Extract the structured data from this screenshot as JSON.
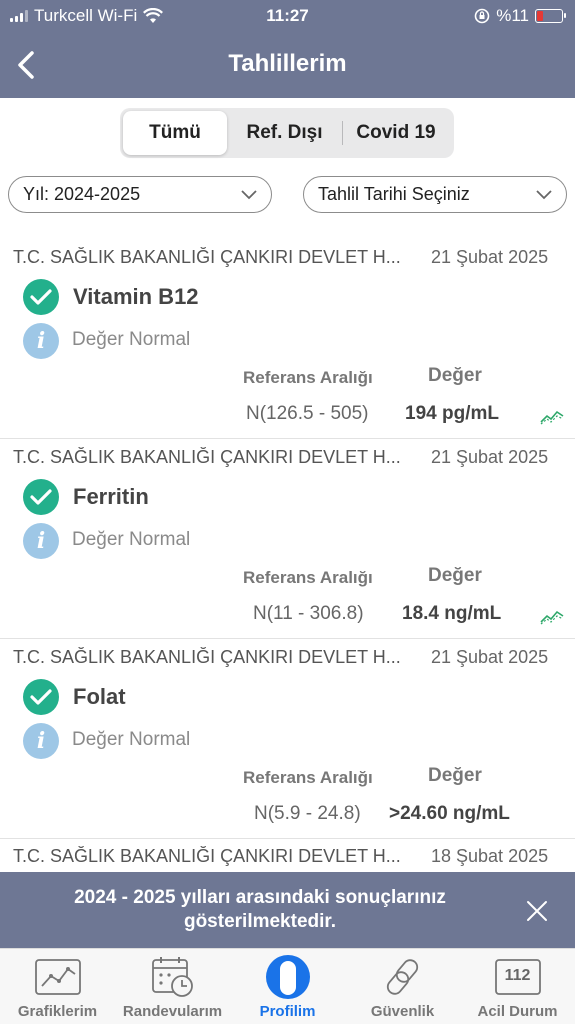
{
  "status_bar": {
    "carrier": "Turkcell Wi-Fi",
    "time": "11:27",
    "battery": "%11"
  },
  "nav": {
    "title": "Tahlillerim"
  },
  "segments": [
    "Tümü",
    "Ref. Dışı",
    "Covid 19"
  ],
  "filters": {
    "year": "Yıl: 2024-2025",
    "date": "Tahlil Tarihi Seçiniz"
  },
  "labels": {
    "ref_header": "Referans Aralığı",
    "value_header": "Değer"
  },
  "results": [
    {
      "org": "T.C. SAĞLIK BAKANLIĞI ÇANKIRI DEVLET H...",
      "date": "21 Şubat 2025",
      "test": "Vitamin B12",
      "status": "Değer Normal",
      "ref": "N(126.5 - 505)",
      "value": "194 pg/mL"
    },
    {
      "org": "T.C. SAĞLIK BAKANLIĞI ÇANKIRI DEVLET H...",
      "date": "21 Şubat 2025",
      "test": "Ferritin",
      "status": "Değer Normal",
      "ref": "N(11 - 306.8)",
      "value": "18.4 ng/mL"
    },
    {
      "org": "T.C. SAĞLIK BAKANLIĞI ÇANKIRI DEVLET H...",
      "date": "21 Şubat 2025",
      "test": "Folat",
      "status": "Değer Normal",
      "ref": "N(5.9 - 24.8)",
      "value": ">24.60 ng/mL"
    }
  ],
  "partial": {
    "org": "T.C. SAĞLIK BAKANLIĞI ÇANKIRI DEVLET H...",
    "date": "18 Şubat 2025"
  },
  "toast": {
    "line1": "2024 - 2025 yılları arasındaki sonuçlarınız",
    "line2": "gösterilmektedir."
  },
  "tabs": [
    "Grafiklerim",
    "Randevularım",
    "Profilim",
    "Güvenlik",
    "Acil Durum"
  ],
  "emergency_number": "112",
  "colors": {
    "header": "#6e7794",
    "check": "#23b08c",
    "info": "#9ec7e6",
    "active_tab": "#1a73e8"
  }
}
